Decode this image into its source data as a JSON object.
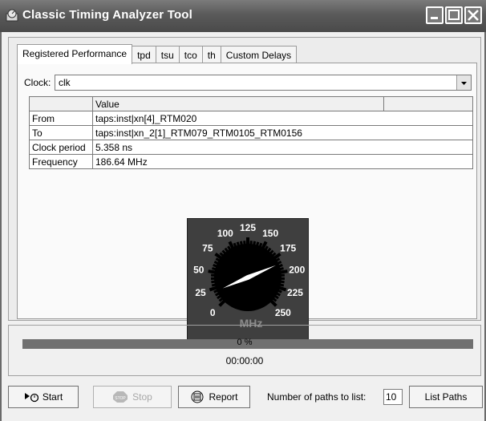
{
  "window": {
    "title": "Classic Timing Analyzer Tool"
  },
  "tabs": [
    {
      "label": "Registered Performance",
      "active": true
    },
    {
      "label": "tpd",
      "active": false
    },
    {
      "label": "tsu",
      "active": false
    },
    {
      "label": "tco",
      "active": false
    },
    {
      "label": "th",
      "active": false
    },
    {
      "label": "Custom Delays",
      "active": false
    }
  ],
  "clock": {
    "label": "Clock:",
    "value": "clk"
  },
  "table": {
    "header": "Value",
    "rows": [
      {
        "name": "From",
        "value": "taps:inst|xn[4]_RTM020"
      },
      {
        "name": "To",
        "value": "taps:inst|xn_2[1]_RTM079_RTM0105_RTM0156"
      },
      {
        "name": "Clock period",
        "value": "5.358 ns"
      },
      {
        "name": "Frequency",
        "value": "186.64 MHz"
      }
    ]
  },
  "gauge": {
    "unit": "MHz",
    "labels": [
      "0",
      "25",
      "50",
      "75",
      "100",
      "125",
      "150",
      "175",
      "200",
      "225",
      "250"
    ],
    "min": 0,
    "max": 250,
    "value": 186.64,
    "colors": {
      "background": "#3f3f3f",
      "dial": "#000000",
      "needle": "#ffffff",
      "unit": "#8a8a8a"
    }
  },
  "progress": {
    "percent_text": "0 %",
    "time": "00:00:00",
    "percent": 0
  },
  "buttons": {
    "start": "Start",
    "stop": "Stop",
    "report": "Report",
    "paths_label": "Number of paths to list:",
    "paths_value": "10",
    "list_paths": "List Paths"
  }
}
